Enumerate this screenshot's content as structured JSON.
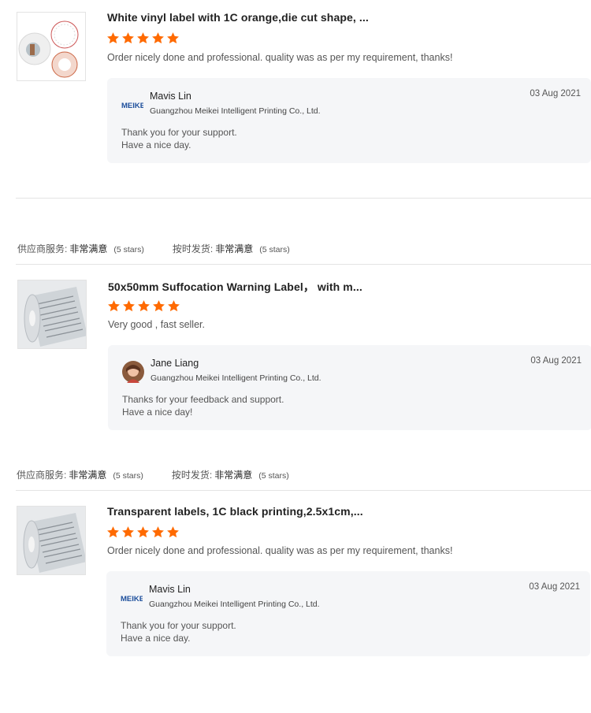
{
  "colors": {
    "star": "#ff6a00",
    "reply_bg": "#f5f6f8"
  },
  "reviews": [
    {
      "product_title": "White vinyl label with 1C orange,die cut shape, ...",
      "rating": 5,
      "comment": "Order nicely done and professional. quality was as per my requirement, thanks!",
      "reply": {
        "name": "Mavis Lin",
        "company": "Guangzhou Meikei Intelligent Printing Co., Ltd.",
        "date": "03 Aug 2021",
        "lines": [
          "Thank you for your support.",
          "Have a nice day."
        ],
        "avatar_text": "MEIKEI"
      }
    },
    {
      "ratings": {
        "service_label": "供应商服务:",
        "service_value": "非常满意",
        "service_stars": "(5 stars)",
        "ship_label": "按时发货:",
        "ship_value": "非常满意",
        "ship_stars": "(5 stars)"
      },
      "product_title": "50x50mm Suffocation Warning Label，  with m...",
      "rating": 5,
      "comment": "Very good , fast seller.",
      "reply": {
        "name": "Jane Liang",
        "company": "Guangzhou Meikei Intelligent Printing Co., Ltd.",
        "date": "03 Aug 2021",
        "lines": [
          "Thanks for your feedback and support.",
          "Have a nice day!"
        ]
      }
    },
    {
      "ratings": {
        "service_label": "供应商服务:",
        "service_value": "非常满意",
        "service_stars": "(5 stars)",
        "ship_label": "按时发货:",
        "ship_value": "非常满意",
        "ship_stars": "(5 stars)"
      },
      "product_title": "Transparent labels, 1C black printing,2.5x1cm,...",
      "rating": 5,
      "comment": "Order nicely done and professional. quality was as per my requirement, thanks!",
      "reply": {
        "name": "Mavis Lin",
        "company": "Guangzhou Meikei Intelligent Printing Co., Ltd.",
        "date": "03 Aug 2021",
        "lines": [
          "Thank you for your support.",
          "Have a nice day."
        ],
        "avatar_text": "MEIKEI"
      }
    }
  ]
}
